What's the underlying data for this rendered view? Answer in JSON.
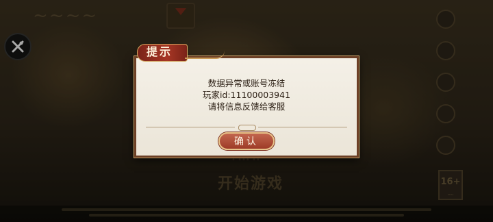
{
  "dialog": {
    "title": "提示",
    "lines": [
      "数据异常或账号冻结",
      "玩家id:11100003941",
      "请将信息反馈给客服"
    ],
    "confirm_label": "确认"
  },
  "background": {
    "start_label": "开始游戏",
    "age_rating": "16+"
  },
  "colors": {
    "dialog_border": "#6b3f25",
    "ribbon": "#a63624",
    "button": "#b04e37",
    "dialog_bg": "#f2eee4"
  },
  "icons": [
    "x-app-icon",
    "notice-arrow-icon",
    "side-menu-icons"
  ]
}
